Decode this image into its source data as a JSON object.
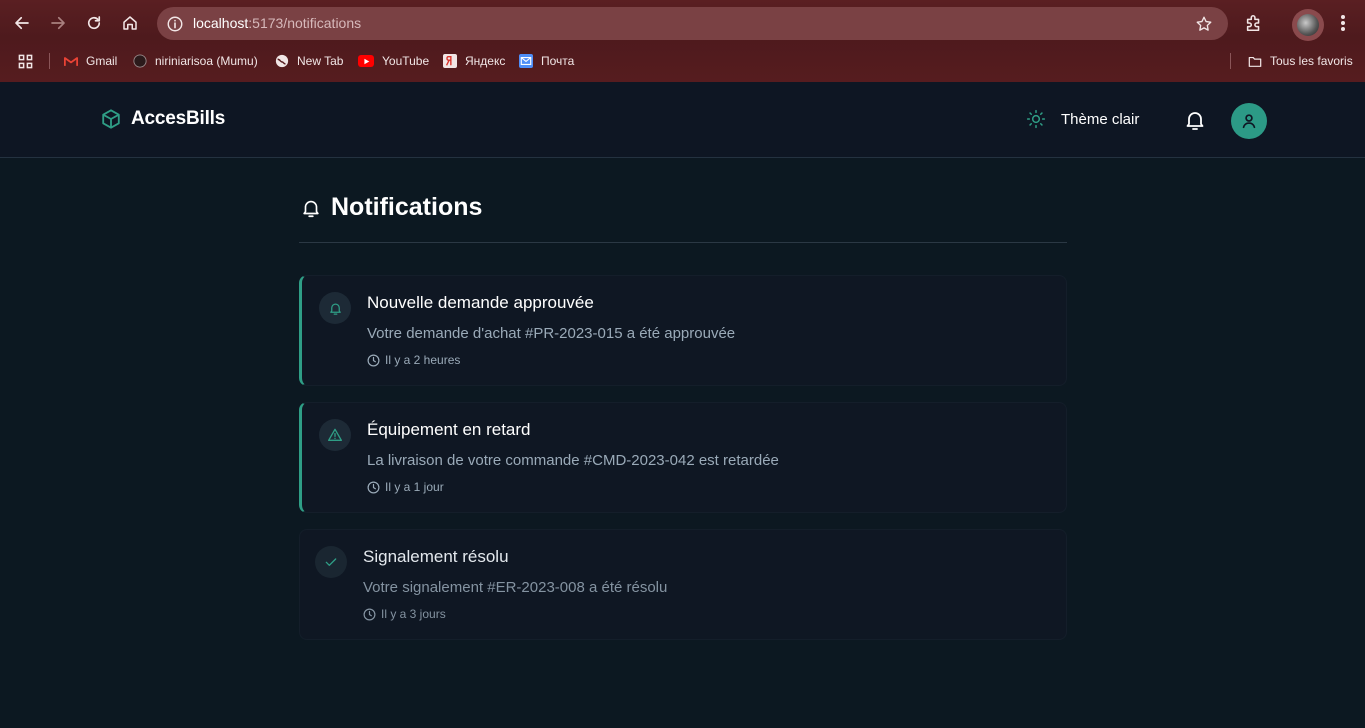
{
  "browser": {
    "url_host": "localhost",
    "url_path": ":5173/notifications",
    "bookmarks": [
      {
        "label": "Gmail",
        "icon": "gmail-icon"
      },
      {
        "label": "niriniarisoa (Mumu)",
        "icon": "github-icon"
      },
      {
        "label": "New Tab",
        "icon": "globe-icon"
      },
      {
        "label": "YouTube",
        "icon": "youtube-icon"
      },
      {
        "label": "Яндекс",
        "icon": "yandex-icon"
      },
      {
        "label": "Почта",
        "icon": "mail-icon"
      }
    ],
    "all_bookmarks_label": "Tous les favoris"
  },
  "header": {
    "brand": "AccesBills",
    "theme_label": "Thème clair"
  },
  "page": {
    "title": "Notifications"
  },
  "notifications": [
    {
      "title": "Nouvelle demande approuvée",
      "message": "Votre demande d'achat #PR-2023-015 a été approuvée",
      "time": "Il y a 2 heures",
      "icon": "bell-icon",
      "read": false
    },
    {
      "title": "Équipement en retard",
      "message": "La livraison de votre commande #CMD-2023-042 est retardée",
      "time": "Il y a 1 jour",
      "icon": "warning-icon",
      "read": false
    },
    {
      "title": "Signalement résolu",
      "message": "Votre signalement #ER-2023-008 a été résolu",
      "time": "Il y a 3 jours",
      "icon": "check-icon",
      "read": true
    }
  ],
  "colors": {
    "accent": "#2f9e86",
    "background": "#0c1821",
    "card": "#0f1723",
    "chrome": "#561c1f"
  }
}
